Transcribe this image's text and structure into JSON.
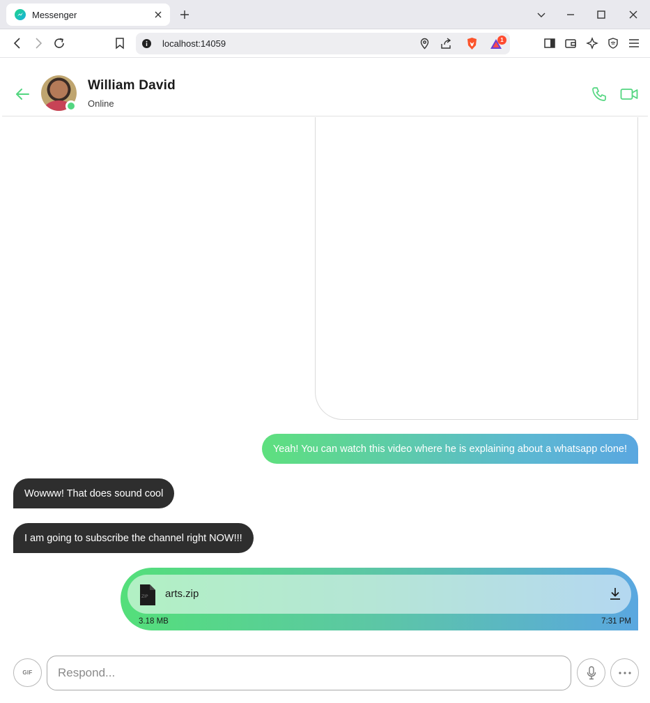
{
  "browser": {
    "tab_title": "Messenger",
    "url": "localhost:14059",
    "rewards_badge": "1"
  },
  "header": {
    "contact_name": "William David",
    "status": "Online"
  },
  "messages": [
    {
      "direction": "outgoing",
      "text": "Yeah! You can watch this video where he is explaining about a whatsapp clone!"
    },
    {
      "direction": "incoming",
      "text": "Wowww! That does sound cool"
    },
    {
      "direction": "incoming",
      "text": "I am going to subscribe the channel right NOW!!!"
    }
  ],
  "file_message": {
    "direction": "outgoing",
    "icon_label": "ZIP",
    "file_name": "arts.zip",
    "file_size": "3.18 MB",
    "time": "7:31 PM"
  },
  "composer": {
    "gif_label": "GIF",
    "placeholder": "Respond..."
  },
  "colors": {
    "accent_green": "#53d680",
    "bubble_gradient_start": "#5ee07e",
    "bubble_gradient_end": "#5aa7e0",
    "incoming_bubble": "#2e2e2e"
  },
  "icons": [
    "messenger-favicon",
    "close-icon",
    "plus-icon",
    "chevron-down-icon",
    "minimize-icon",
    "maximize-icon",
    "back-icon",
    "forward-icon",
    "reload-icon",
    "bookmark-icon",
    "info-icon",
    "location-icon",
    "share-icon",
    "brave-shield-icon",
    "rewards-icon",
    "sidebar-icon",
    "wallet-icon",
    "leo-icon",
    "vpn-icon",
    "menu-icon",
    "arrow-left-icon",
    "phone-icon",
    "video-camera-icon",
    "zip-file-icon",
    "download-icon",
    "microphone-icon",
    "more-horizontal-icon"
  ]
}
